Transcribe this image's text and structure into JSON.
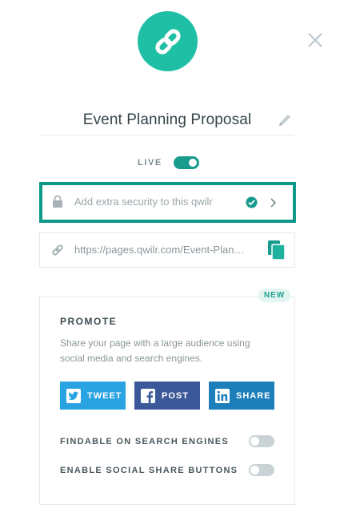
{
  "header": {
    "logo_icon": "link-chain-icon",
    "close_icon": "close-icon",
    "brand_color": "#1fbfa6"
  },
  "page": {
    "title": "Event Planning Proposal",
    "edit_icon": "pencil-icon"
  },
  "live": {
    "label": "LIVE",
    "enabled": true,
    "toggle_color": "#169b8c"
  },
  "security": {
    "text": "Add extra security to this qwilr",
    "lock_icon": "lock-icon",
    "status_icon": "check-circle-icon",
    "chevron_icon": "chevron-right-icon",
    "border_color": "#0d9a8a"
  },
  "link": {
    "url": "https://pages.qwilr.com/Event-Plan…",
    "link_icon": "link-icon",
    "copy_icon": "copy-icon"
  },
  "promote": {
    "badge": "NEW",
    "title": "PROMOTE",
    "description": "Share your page with a large audience using social media and search engines.",
    "buttons": [
      {
        "label": "TWEET",
        "icon": "twitter-icon",
        "color": "#2aa3e2"
      },
      {
        "label": "POST",
        "icon": "facebook-icon",
        "color": "#3b5998"
      },
      {
        "label": "SHARE",
        "icon": "linkedin-icon",
        "color": "#1c7fba"
      }
    ],
    "options": [
      {
        "label": "FINDABLE ON SEARCH ENGINES",
        "enabled": false
      },
      {
        "label": "ENABLE SOCIAL SHARE BUTTONS",
        "enabled": false
      }
    ]
  }
}
